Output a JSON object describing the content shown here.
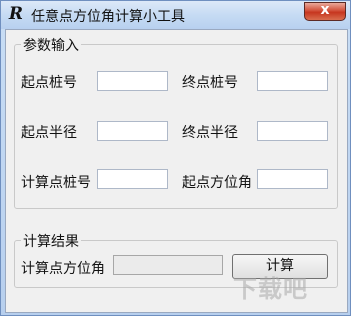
{
  "window": {
    "title": "任意点方位角计算小工具",
    "icon_letter": "R",
    "close_label": "x"
  },
  "input_group": {
    "title": "参数输入",
    "start_stake_label": "起点桩号",
    "end_stake_label": "终点桩号",
    "start_radius_label": "起点半径",
    "end_radius_label": "终点半径",
    "calc_stake_label": "计算点桩号",
    "start_azimuth_label": "起点方位角",
    "start_stake_value": "",
    "end_stake_value": "",
    "start_radius_value": "",
    "end_radius_value": "",
    "calc_stake_value": "",
    "start_azimuth_value": ""
  },
  "result_group": {
    "title": "计算结果",
    "azimuth_label": "计算点方位角",
    "azimuth_value": "",
    "calc_button_label": "计算"
  },
  "watermark": {
    "text": "下载吧"
  }
}
